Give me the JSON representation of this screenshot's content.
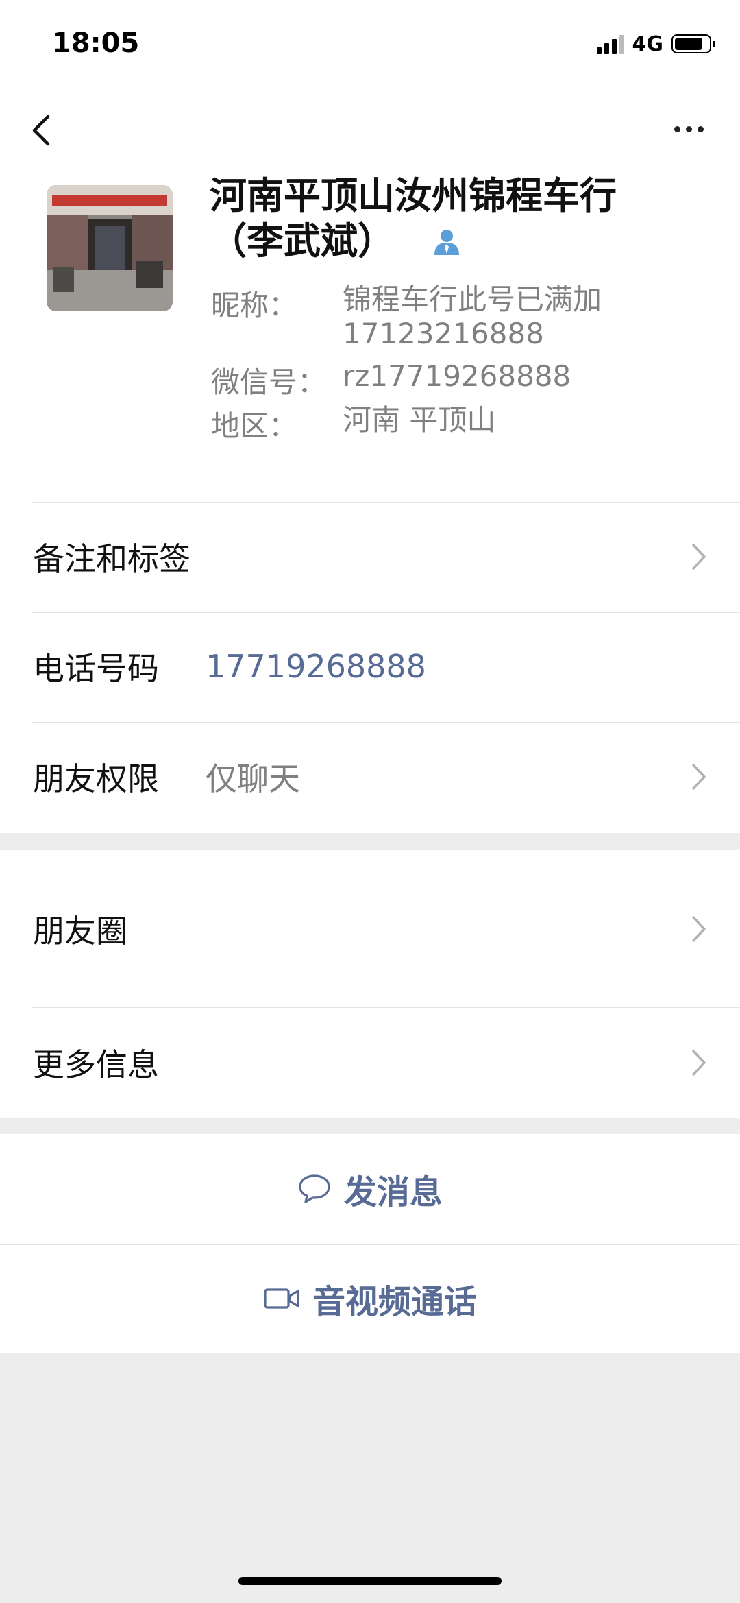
{
  "status_bar": {
    "time": "18:05",
    "network": "4G"
  },
  "profile": {
    "name_line1": "河南平顶山汝州锦程车行",
    "name_line2": "（李武斌）",
    "nickname_label": "昵称：",
    "nickname_value": "锦程车行此号已满加17123216888",
    "wechat_id_label": "微信号：",
    "wechat_id_value": "rz17719268888",
    "region_label": "地区：",
    "region_value": "河南  平顶山"
  },
  "rows": {
    "remarks_label": "备注和标签",
    "phone_label": "电话号码",
    "phone_value": "17719268888",
    "permission_label": "朋友权限",
    "permission_value": "仅聊天",
    "moments_label": "朋友圈",
    "more_info_label": "更多信息"
  },
  "actions": {
    "message_label": "发消息",
    "call_label": "音视频通话"
  },
  "colors": {
    "link": "#576b95",
    "muted": "#808080",
    "background": "#ededed"
  }
}
